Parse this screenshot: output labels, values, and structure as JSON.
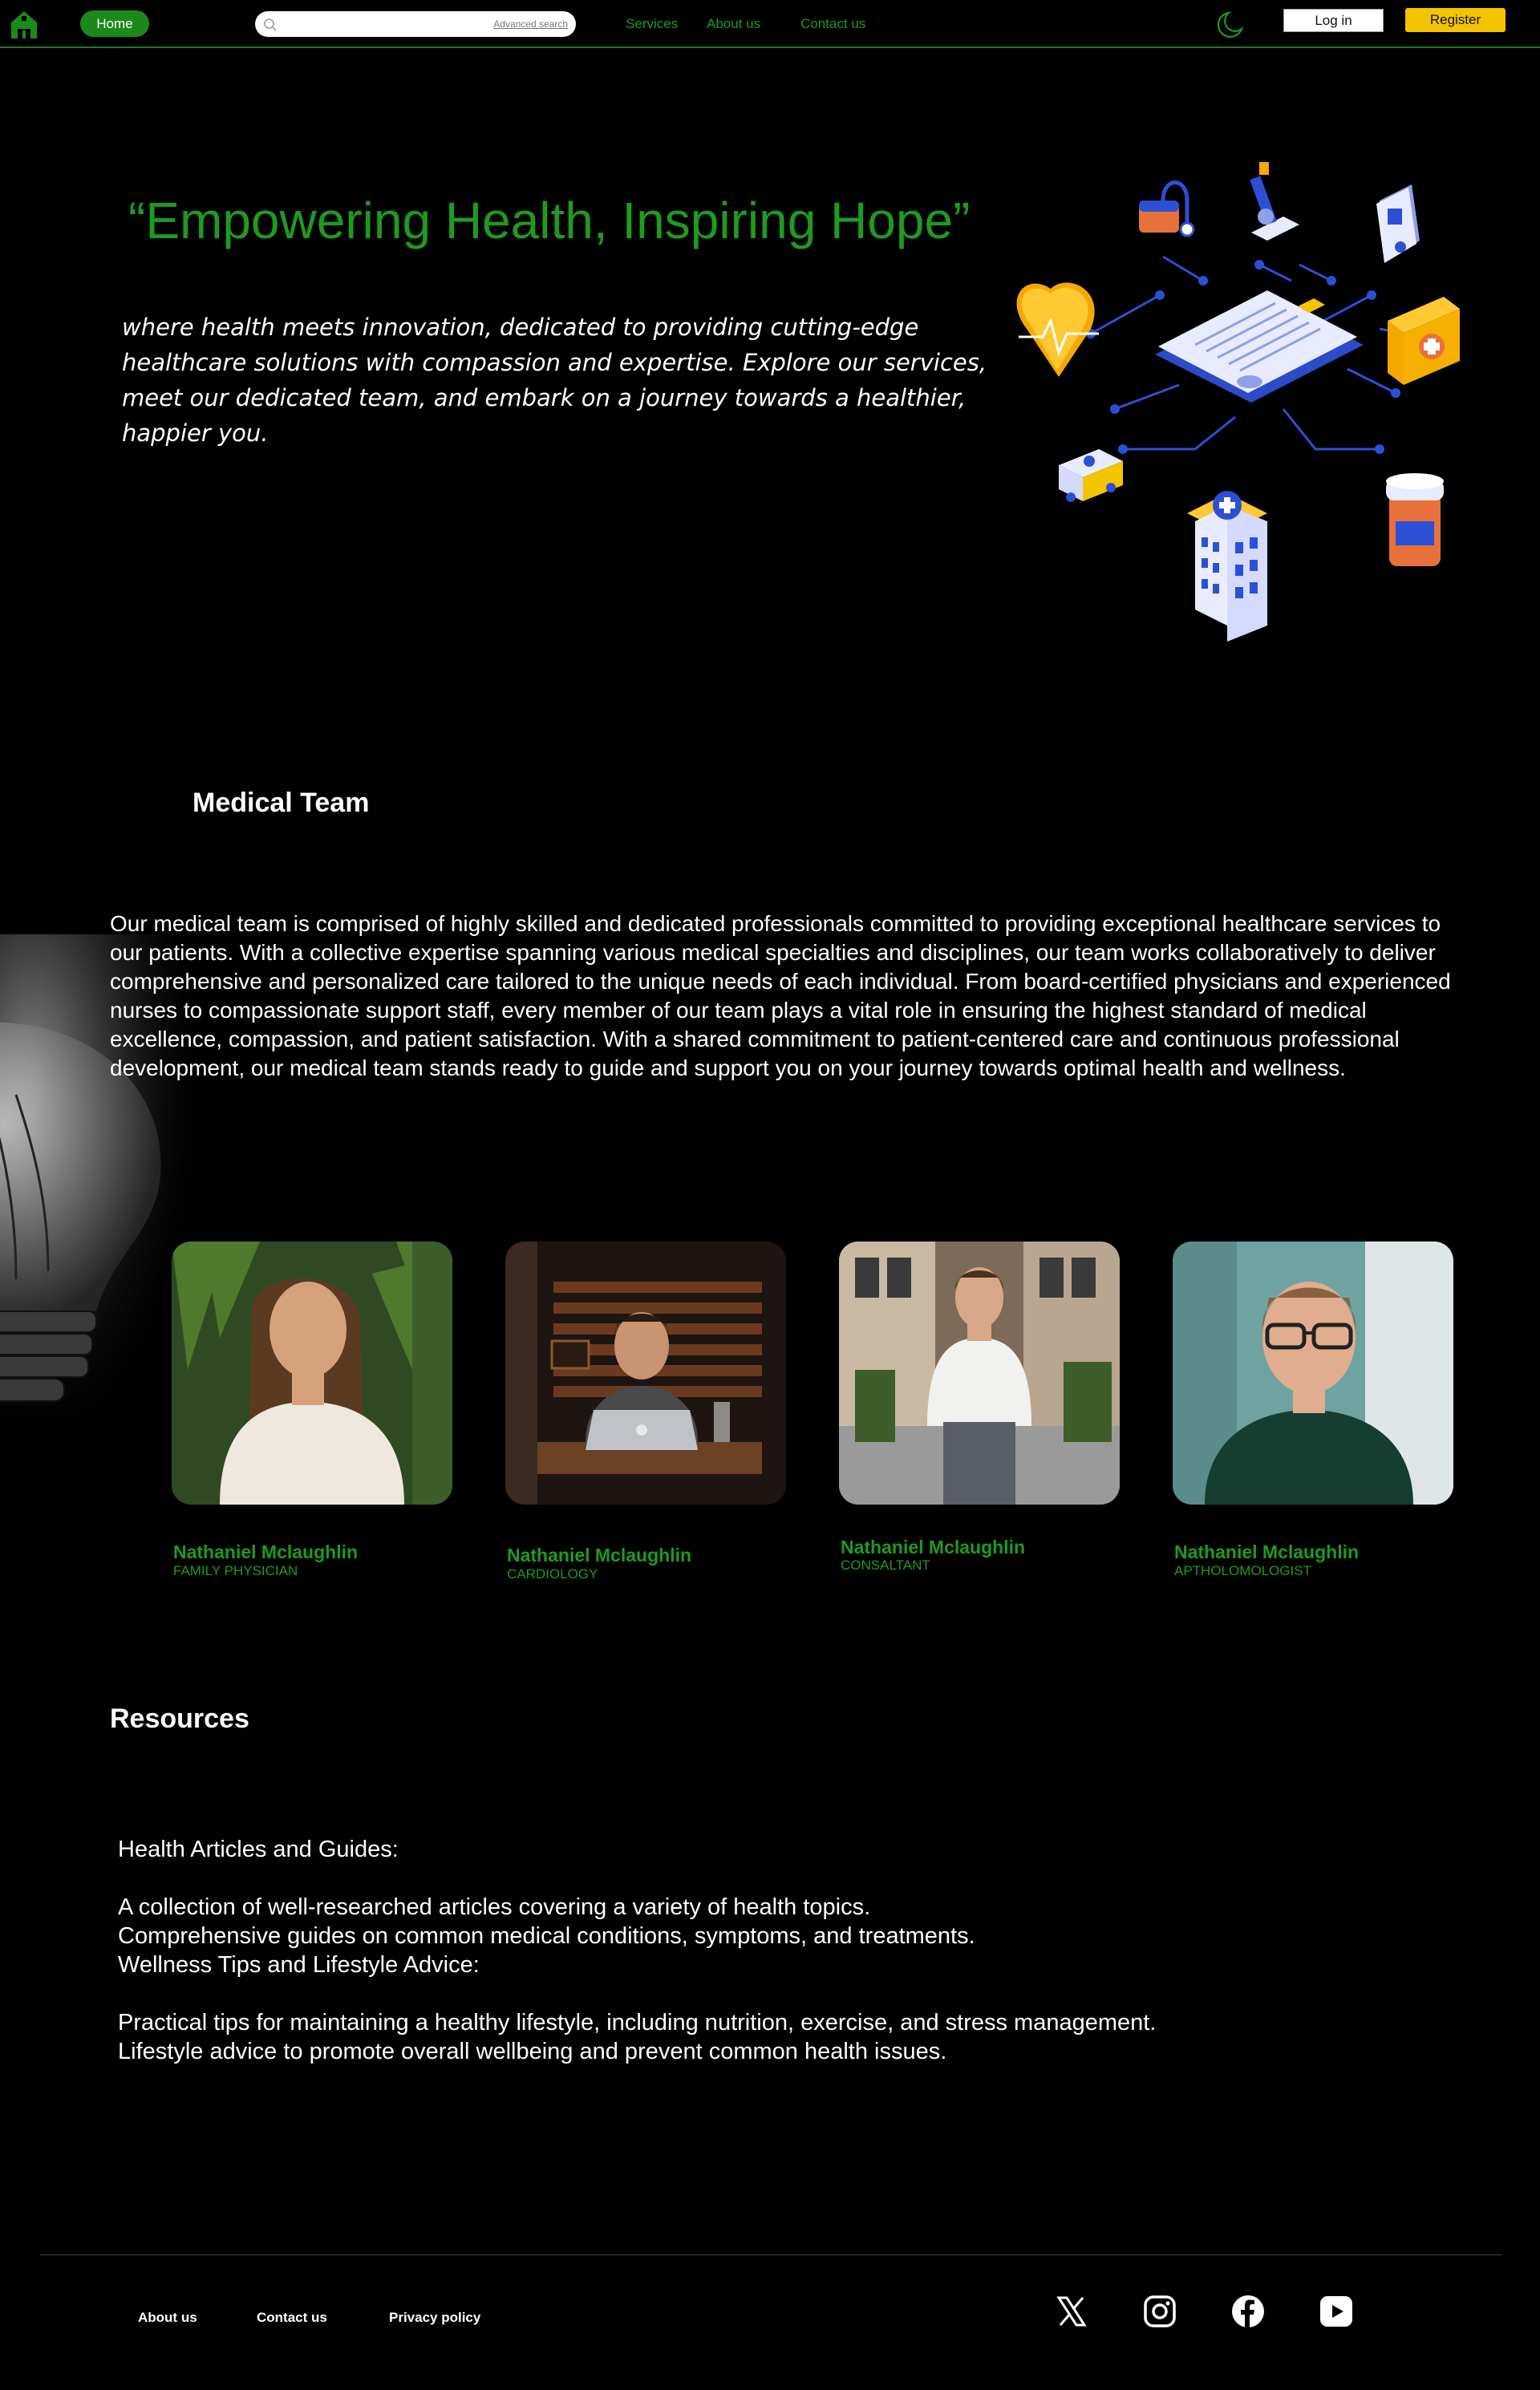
{
  "nav": {
    "home_label": "Home",
    "search_placeholder": "",
    "advanced_search_label": "Advanced search",
    "links": [
      "Services",
      "About us",
      "Contact us"
    ],
    "login_label": "Log in",
    "register_label": "Register"
  },
  "hero": {
    "title": "“Empowering Health, Inspiring Hope”",
    "subtitle": "where health meets innovation, dedicated to providing cutting-edge healthcare solutions with compassion and expertise. Explore our services, meet our dedicated team, and embark on a journey towards a healthier, happier you."
  },
  "team": {
    "heading": "Medical Team",
    "description": "Our medical team is comprised of highly skilled and dedicated professionals committed to providing exceptional healthcare services to our patients. With a collective expertise spanning various medical specialties and disciplines, our team works collaboratively to deliver comprehensive and personalized care tailored to the unique needs of each individual. From board-certified physicians and experienced nurses to compassionate support staff, every member of our team plays a vital role in ensuring the highest standard of medical excellence, compassion, and patient satisfaction. With a shared commitment to patient-centered care and continuous professional development, our medical team stands ready to guide and support you on your journey towards optimal health and wellness.",
    "members": [
      {
        "name": "Nathaniel Mclaughlin",
        "role": "FAMILY PHYSICIAN"
      },
      {
        "name": "Nathaniel Mclaughlin",
        "role": "CARDIOLOGY"
      },
      {
        "name": "Nathaniel Mclaughlin",
        "role": "CONSALTANT"
      },
      {
        "name": "Nathaniel Mclaughlin",
        "role": "APTHOLOMOLOGIST"
      }
    ]
  },
  "resources": {
    "heading": "Resources",
    "lines": [
      "Health Articles and Guides:",
      "A collection of well-researched articles covering a variety of health topics.",
      "Comprehensive guides on common medical conditions, symptoms, and treatments.",
      "Wellness Tips and Lifestyle Advice:",
      "Practical tips for maintaining a healthy lifestyle, including nutrition, exercise, and stress management.",
      "Lifestyle advice to promote overall wellbeing and prevent common health issues."
    ]
  },
  "footer": {
    "links": [
      "About us",
      "Contact us",
      "Privacy policy"
    ],
    "socials": [
      "x-icon",
      "instagram-icon",
      "facebook-icon",
      "youtube-icon"
    ]
  },
  "colors": {
    "background": "#000000",
    "accent_green": "#1f9a1f",
    "register_yellow": "#f5c400"
  }
}
